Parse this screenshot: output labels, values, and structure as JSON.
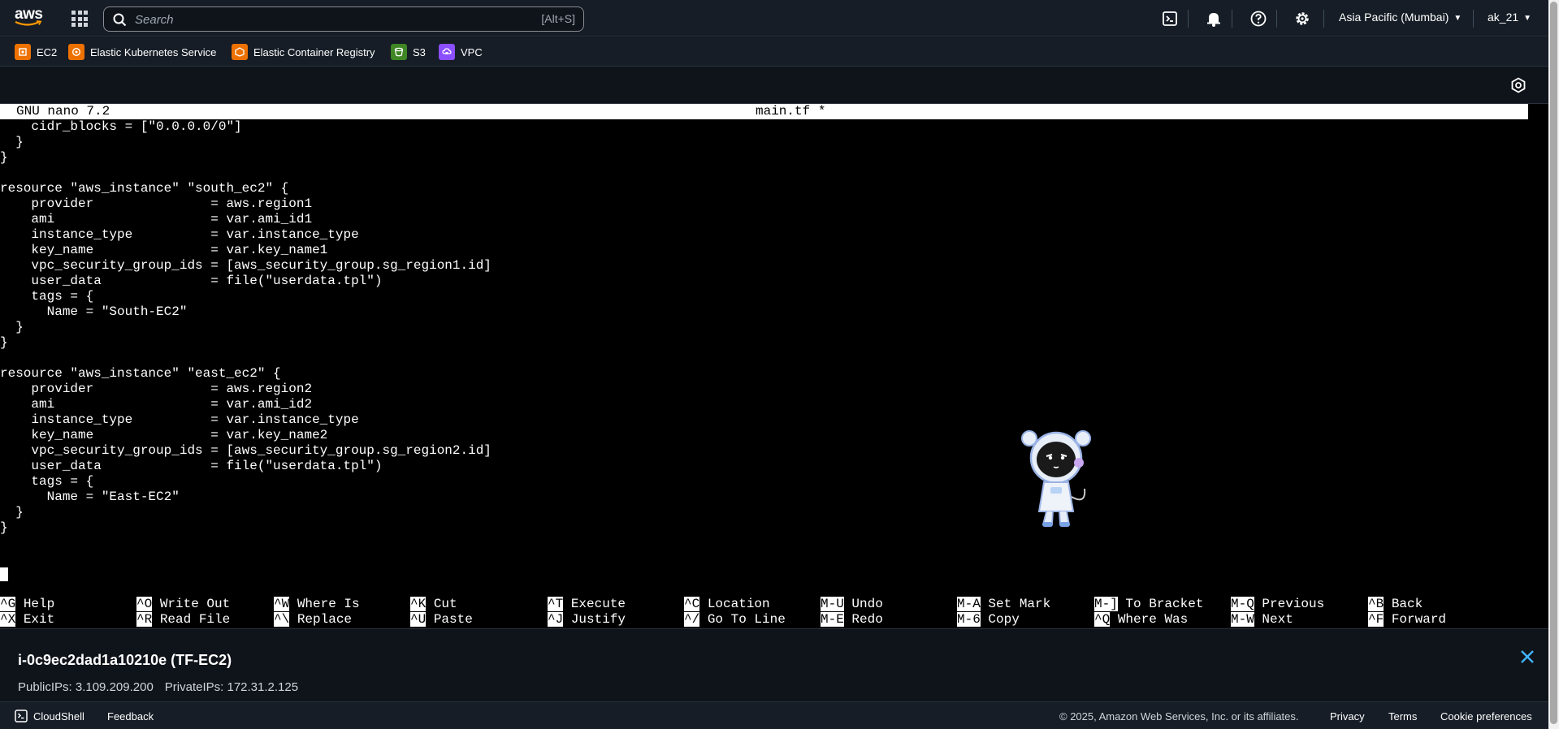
{
  "topnav": {
    "search_placeholder": "Search",
    "search_shortcut": "[Alt+S]",
    "region": "Asia Pacific (Mumbai)",
    "user": "ak_21"
  },
  "favorites": [
    {
      "label": "EC2",
      "color": "#ed7100"
    },
    {
      "label": "Elastic Kubernetes Service",
      "color": "#ed7100"
    },
    {
      "label": "Elastic Container Registry",
      "color": "#ed7100"
    },
    {
      "label": "S3",
      "color": "#3f8624"
    },
    {
      "label": "VPC",
      "color": "#8c4fff"
    }
  ],
  "terminal": {
    "app": "GNU nano 7.2",
    "filename": "main.tf *",
    "lines": [
      "    cidr_blocks = [\"0.0.0.0/0\"]",
      "  }",
      "}",
      "",
      "resource \"aws_instance\" \"south_ec2\" {",
      "    provider               = aws.region1",
      "    ami                    = var.ami_id1",
      "    instance_type          = var.instance_type",
      "    key_name               = var.key_name1",
      "    vpc_security_group_ids = [aws_security_group.sg_region1.id]",
      "    user_data              = file(\"userdata.tpl\")",
      "    tags = {",
      "      Name = \"South-EC2\"",
      "  }",
      "}",
      "",
      "resource \"aws_instance\" \"east_ec2\" {",
      "    provider               = aws.region2",
      "    ami                    = var.ami_id2",
      "    instance_type          = var.instance_type",
      "    key_name               = var.key_name2",
      "    vpc_security_group_ids = [aws_security_group.sg_region2.id]",
      "    user_data              = file(\"userdata.tpl\")",
      "    tags = {",
      "      Name = \"East-EC2\"",
      "  }",
      "}"
    ],
    "shortcuts_row1": [
      {
        "key": "^G",
        "label": "Help"
      },
      {
        "key": "^O",
        "label": "Write Out"
      },
      {
        "key": "^W",
        "label": "Where Is"
      },
      {
        "key": "^K",
        "label": "Cut"
      },
      {
        "key": "^T",
        "label": "Execute"
      },
      {
        "key": "^C",
        "label": "Location"
      },
      {
        "key": "M-U",
        "label": "Undo"
      },
      {
        "key": "M-A",
        "label": "Set Mark"
      },
      {
        "key": "M-]",
        "label": "To Bracket"
      },
      {
        "key": "M-Q",
        "label": "Previous"
      },
      {
        "key": "^B",
        "label": "Back"
      }
    ],
    "shortcuts_row2": [
      {
        "key": "^X",
        "label": "Exit"
      },
      {
        "key": "^R",
        "label": "Read File"
      },
      {
        "key": "^\\",
        "label": "Replace"
      },
      {
        "key": "^U",
        "label": "Paste"
      },
      {
        "key": "^J",
        "label": "Justify"
      },
      {
        "key": "^/",
        "label": "Go To Line"
      },
      {
        "key": "M-E",
        "label": "Redo"
      },
      {
        "key": "M-6",
        "label": "Copy"
      },
      {
        "key": "^Q",
        "label": "Where Was"
      },
      {
        "key": "M-W",
        "label": "Next"
      },
      {
        "key": "^F",
        "label": "Forward"
      }
    ]
  },
  "instance": {
    "title": "i-0c9ec2dad1a10210e (TF-EC2)",
    "public_ips": "PublicIPs: 3.109.209.200",
    "private_ips": "PrivateIPs: 172.31.2.125"
  },
  "footer": {
    "cloudshell": "CloudShell",
    "feedback": "Feedback",
    "copyright": "© 2025, Amazon Web Services, Inc. or its affiliates.",
    "privacy": "Privacy",
    "terms": "Terms",
    "cookies": "Cookie preferences"
  }
}
